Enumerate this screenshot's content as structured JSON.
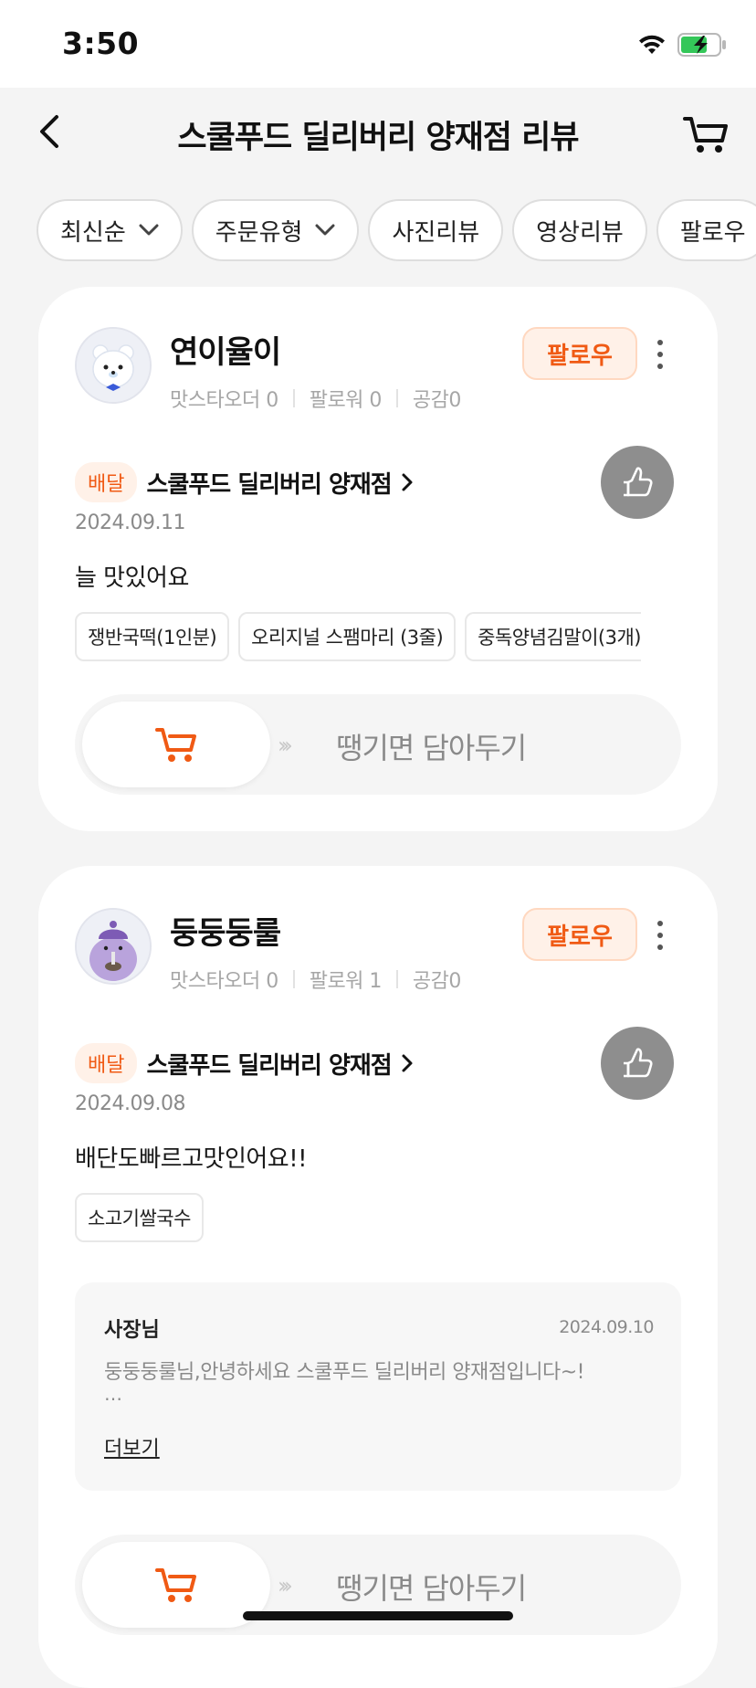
{
  "status_bar": {
    "time": "3:50"
  },
  "header": {
    "title": "스쿨푸드 딜리버리 양재점 리뷰"
  },
  "filters": [
    {
      "label": "최신순",
      "dropdown": true
    },
    {
      "label": "주문유형",
      "dropdown": true
    },
    {
      "label": "사진리뷰",
      "dropdown": false
    },
    {
      "label": "영상리뷰",
      "dropdown": false
    },
    {
      "label": "팔로우",
      "dropdown": false
    }
  ],
  "reviews": [
    {
      "nickname": "연이율이",
      "stats": {
        "mastar_order": "맛스타오더 0",
        "followers": "팔로워 0",
        "empathy": "공감0"
      },
      "follow_label": "팔로우",
      "order_type": "배달",
      "store_name": "스쿨푸드 딜리버리 양재점",
      "date": "2024.09.11",
      "text": "늘 맛있어요",
      "menu_items": [
        "쟁반국떡(1인분)",
        "오리지널 스팸마리 (3줄)",
        "중독양념김말이(3개)"
      ],
      "cart_label": "땡기면 담아두기",
      "avatar_color": "#eef0f6"
    },
    {
      "nickname": "둥둥둥룰",
      "stats": {
        "mastar_order": "맛스타오더 0",
        "followers": "팔로워 1",
        "empathy": "공감0"
      },
      "follow_label": "팔로우",
      "order_type": "배달",
      "store_name": "스쿨푸드 딜리버리 양재점",
      "date": "2024.09.08",
      "text": "배단도빠르고맛인어요!!",
      "menu_items": [
        "소고기쌀국수"
      ],
      "owner_reply": {
        "name": "사장님",
        "date": "2024.09.10",
        "text": "둥둥둥룰님,안녕하세요 스쿨푸드 딜리버리 양재점입니다~!",
        "ellipsis": "…",
        "more_label": "더보기"
      },
      "cart_label": "땡기면 담아두기",
      "avatar_color": "#b9a3dc"
    }
  ],
  "colors": {
    "accent": "#f05a14",
    "background": "#f4f4f4",
    "card": "#ffffff"
  }
}
